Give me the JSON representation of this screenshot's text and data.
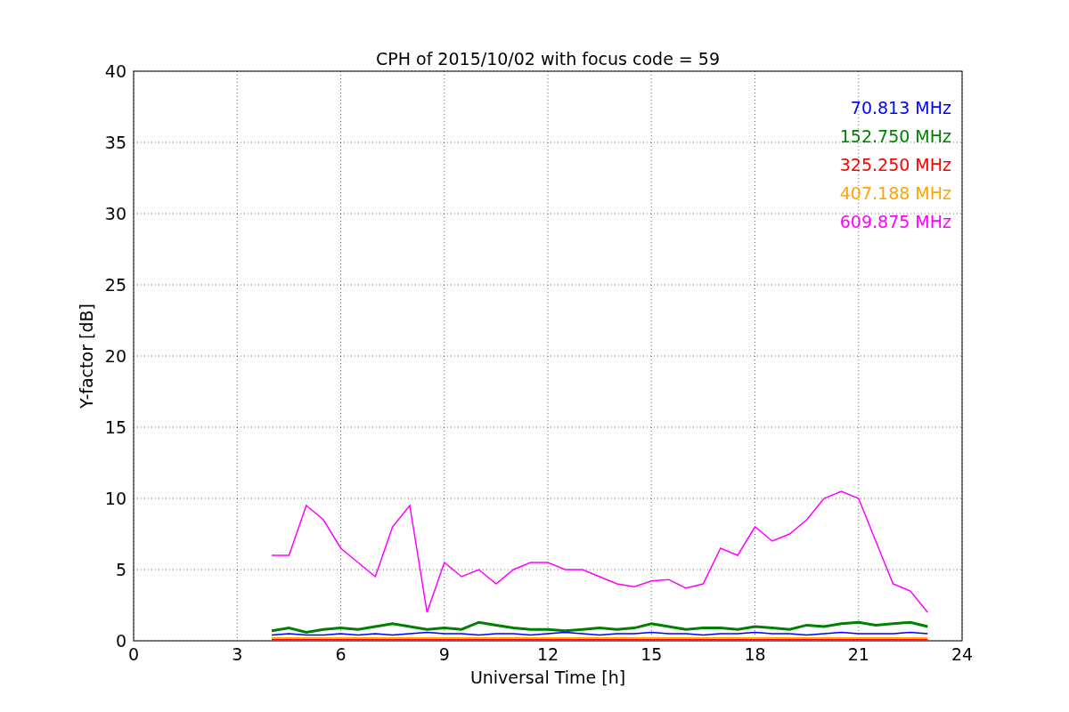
{
  "chart_data": {
    "type": "line",
    "title": "CPH of 2015/10/02 with focus code = 59",
    "xlabel": "Universal Time [h]",
    "ylabel": "Y-factor [dB]",
    "x": [
      4,
      4.5,
      5,
      5.5,
      6,
      6.5,
      7,
      7.5,
      8,
      8.5,
      9,
      9.5,
      10,
      10.5,
      11,
      11.5,
      12,
      12.5,
      13,
      13.5,
      14,
      14.5,
      15,
      15.5,
      16,
      16.5,
      17,
      17.5,
      18,
      18.5,
      19,
      19.5,
      20,
      20.5,
      21,
      21.5,
      22,
      22.5,
      23
    ],
    "series": [
      {
        "name": "70.813 MHz",
        "color": "#0000ff",
        "values": [
          0.4,
          0.5,
          0.4,
          0.4,
          0.5,
          0.4,
          0.5,
          0.4,
          0.5,
          0.6,
          0.5,
          0.5,
          0.4,
          0.5,
          0.5,
          0.4,
          0.5,
          0.6,
          0.5,
          0.4,
          0.5,
          0.5,
          0.6,
          0.5,
          0.5,
          0.4,
          0.5,
          0.5,
          0.6,
          0.5,
          0.5,
          0.4,
          0.5,
          0.6,
          0.5,
          0.5,
          0.5,
          0.6,
          0.5
        ]
      },
      {
        "name": "152.750 MHz",
        "color": "#008000",
        "values": [
          0.7,
          0.9,
          0.6,
          0.8,
          0.9,
          0.8,
          1.0,
          1.2,
          1.0,
          0.8,
          0.9,
          0.8,
          1.3,
          1.1,
          0.9,
          0.8,
          0.8,
          0.7,
          0.8,
          0.9,
          0.8,
          0.9,
          1.2,
          1.0,
          0.8,
          0.9,
          0.9,
          0.8,
          1.0,
          0.9,
          0.8,
          1.1,
          1.0,
          1.2,
          1.3,
          1.1,
          1.2,
          1.3,
          1.0
        ]
      },
      {
        "name": "325.250 MHz",
        "color": "#ff0000",
        "values": [
          0.1,
          0.1,
          0.1,
          0.1,
          0.1,
          0.1,
          0.1,
          0.1,
          0.1,
          0.1,
          0.1,
          0.1,
          0.1,
          0.1,
          0.1,
          0.1,
          0.1,
          0.1,
          0.1,
          0.1,
          0.1,
          0.1,
          0.1,
          0.1,
          0.1,
          0.1,
          0.1,
          0.1,
          0.1,
          0.1,
          0.1,
          0.1,
          0.1,
          0.1,
          0.1,
          0.1,
          0.1,
          0.1,
          0.1
        ]
      },
      {
        "name": "407.188 MHz",
        "color": "#ffa500",
        "values": [
          0.2,
          0.2,
          0.2,
          0.2,
          0.2,
          0.2,
          0.2,
          0.2,
          0.2,
          0.2,
          0.2,
          0.2,
          0.2,
          0.2,
          0.2,
          0.2,
          0.2,
          0.2,
          0.2,
          0.2,
          0.2,
          0.2,
          0.2,
          0.2,
          0.2,
          0.2,
          0.2,
          0.2,
          0.2,
          0.2,
          0.2,
          0.2,
          0.2,
          0.2,
          0.2,
          0.2,
          0.2,
          0.2,
          0.2
        ]
      },
      {
        "name": "609.875 MHz",
        "color": "#ff00ff",
        "values": [
          6.0,
          6.0,
          9.5,
          8.5,
          6.5,
          5.5,
          4.5,
          8.0,
          9.5,
          2.0,
          5.5,
          4.5,
          5.0,
          4.0,
          5.0,
          5.5,
          5.5,
          5.0,
          5.0,
          4.5,
          4.0,
          3.8,
          4.2,
          4.3,
          3.7,
          4.0,
          6.5,
          6.0,
          8.0,
          7.0,
          7.5,
          8.5,
          10.0,
          10.5,
          10.0,
          7.0,
          4.0,
          3.5,
          2.0
        ]
      }
    ],
    "xlim": [
      0,
      24
    ],
    "ylim": [
      0,
      40
    ],
    "xticks": [
      0,
      3,
      6,
      9,
      12,
      15,
      18,
      21,
      24
    ],
    "yticks": [
      0,
      5,
      10,
      15,
      20,
      25,
      30,
      35,
      40
    ],
    "grid": true
  }
}
